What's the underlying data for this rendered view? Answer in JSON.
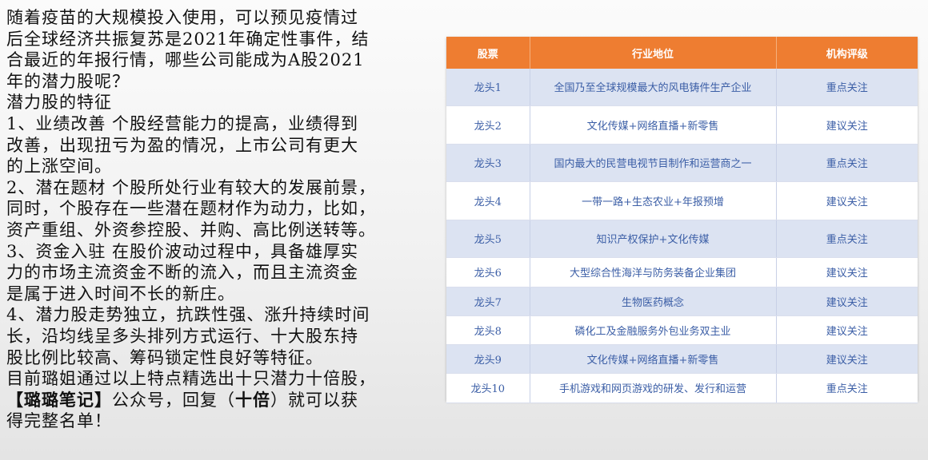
{
  "text": {
    "line1": "随着疫苗的大规模投入使用，可以预见疫情过",
    "line2": "后全球经济共振复苏是2021年确定性事件，结",
    "line3": "合最近的年报行情，哪些公司能成为A股2021",
    "line4": "年的潜力股呢？",
    "line5": "潜力股的特征",
    "line6": "1、业绩改善 个股经营能力的提高，业绩得到",
    "line7": "改善，出现扭亏为盈的情况，上市公司有更大",
    "line8": "的上涨空间。",
    "line9": "2、潜在题材 个股所处行业有较大的发展前景，",
    "line10": "同时，个股存在一些潜在题材作为动力，比如，",
    "line11": "资产重组、外资参控股、并购、高比例送转等。",
    "line12": "3、资金入驻 在股价波动过程中，具备雄厚实",
    "line13": "力的市场主流资金不断的流入，而且主流资金",
    "line14": "是属于进入时间不长的新庄。",
    "line15": "4、潜力股走势独立，抗跌性强、涨升持续时间",
    "line16": "长，沿均线呈多头排列方式运行、十大股东持",
    "line17": "股比例比较高、筹码锁定性良好等特征。",
    "line18": "目前璐姐通过以上特点精选出十只潜力十倍股，",
    "line19_a": "【璐璐笔记】",
    "line19_b": "公众号，回复（",
    "line19_c": "十倍",
    "line19_d": "）就可以获",
    "line20": "得完整名单！"
  },
  "table": {
    "headers": [
      "股票",
      "行业地位",
      "机构评级"
    ],
    "rows": [
      [
        "龙头1",
        "全国乃至全球规模最大的风电铸件生产企业",
        "重点关注"
      ],
      [
        "龙头2",
        "文化传媒+网络直播+新零售",
        "建议关注"
      ],
      [
        "龙头3",
        "国内最大的民营电视节目制作和运营商之一",
        "重点关注"
      ],
      [
        "龙头4",
        "一带一路+生态农业+年报预增",
        "建议关注"
      ],
      [
        "龙头5",
        "知识产权保护+文化传媒",
        "重点关注"
      ],
      [
        "龙头6",
        "大型综合性海洋与防务装备企业集团",
        "建议关注"
      ],
      [
        "龙头7",
        "生物医药概念",
        "建议关注"
      ],
      [
        "龙头8",
        "磷化工及金融服务外包业务双主业",
        "建议关注"
      ],
      [
        "龙头9",
        "文化传媒+网络直播+新零售",
        "建议关注"
      ],
      [
        "龙头10",
        "手机游戏和网页游戏的研发、发行和运营",
        "重点关注"
      ]
    ]
  },
  "colors": {
    "header_bg": "#ee7d31",
    "row_alt_bg": "#dce3f2",
    "cell_text": "#3b5ea6"
  }
}
